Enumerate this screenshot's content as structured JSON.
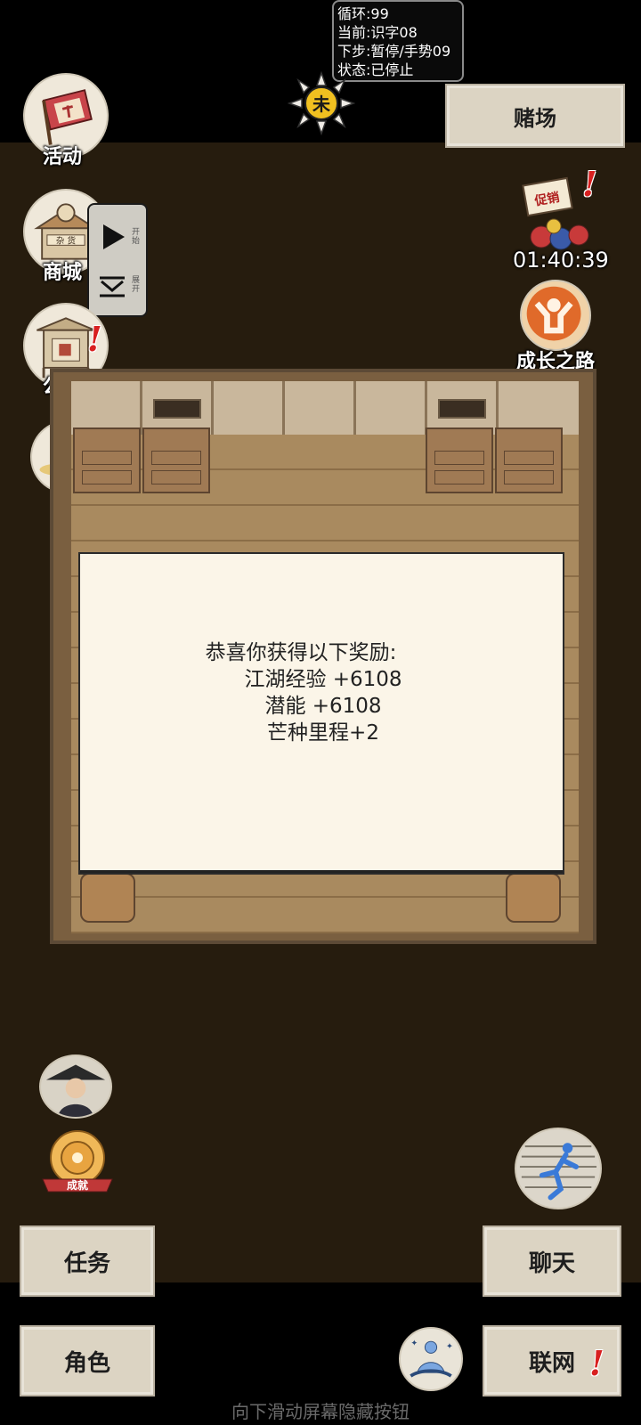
{
  "status": {
    "lines": [
      "循环:99",
      "当前:识字08",
      "下步:暂停/手势09",
      "状态:已停止"
    ]
  },
  "time_glyph": "未",
  "top_right_button": {
    "label": "赌场"
  },
  "left_menu": [
    {
      "label": "活动",
      "icon": "event-flag-icon"
    },
    {
      "label": "商城",
      "icon": "shop-stall-icon",
      "badge": "!"
    },
    {
      "label": "公告",
      "icon": "notice-board-icon",
      "badge": "!"
    },
    {
      "label": "",
      "icon": "wheat-icon"
    }
  ],
  "float_control": {
    "play_label": "开始",
    "collapse_label": "展开"
  },
  "right_menu": {
    "promo": {
      "sign": "促销",
      "timer": "01:40:39",
      "badge": "!"
    },
    "growth": {
      "label": "成长之路"
    }
  },
  "reward_dialog": {
    "title": "恭喜你获得以下奖励:",
    "lines": [
      "江湖经验 +6108",
      "潜能 +6108",
      "芒种里程+2"
    ]
  },
  "bottom_left": {
    "achievement_label": "成就"
  },
  "buttons": {
    "task": "任务",
    "role": "角色",
    "chat": "聊天",
    "network": "联网",
    "network_badge": "!"
  },
  "bottom_hint": "向下滑动屏幕隐藏按钮",
  "colors": {
    "background": "#261c0e",
    "paper_button": "#dcd4c3",
    "dialog": "#fbf5e8",
    "alert_red": "#d82020"
  }
}
